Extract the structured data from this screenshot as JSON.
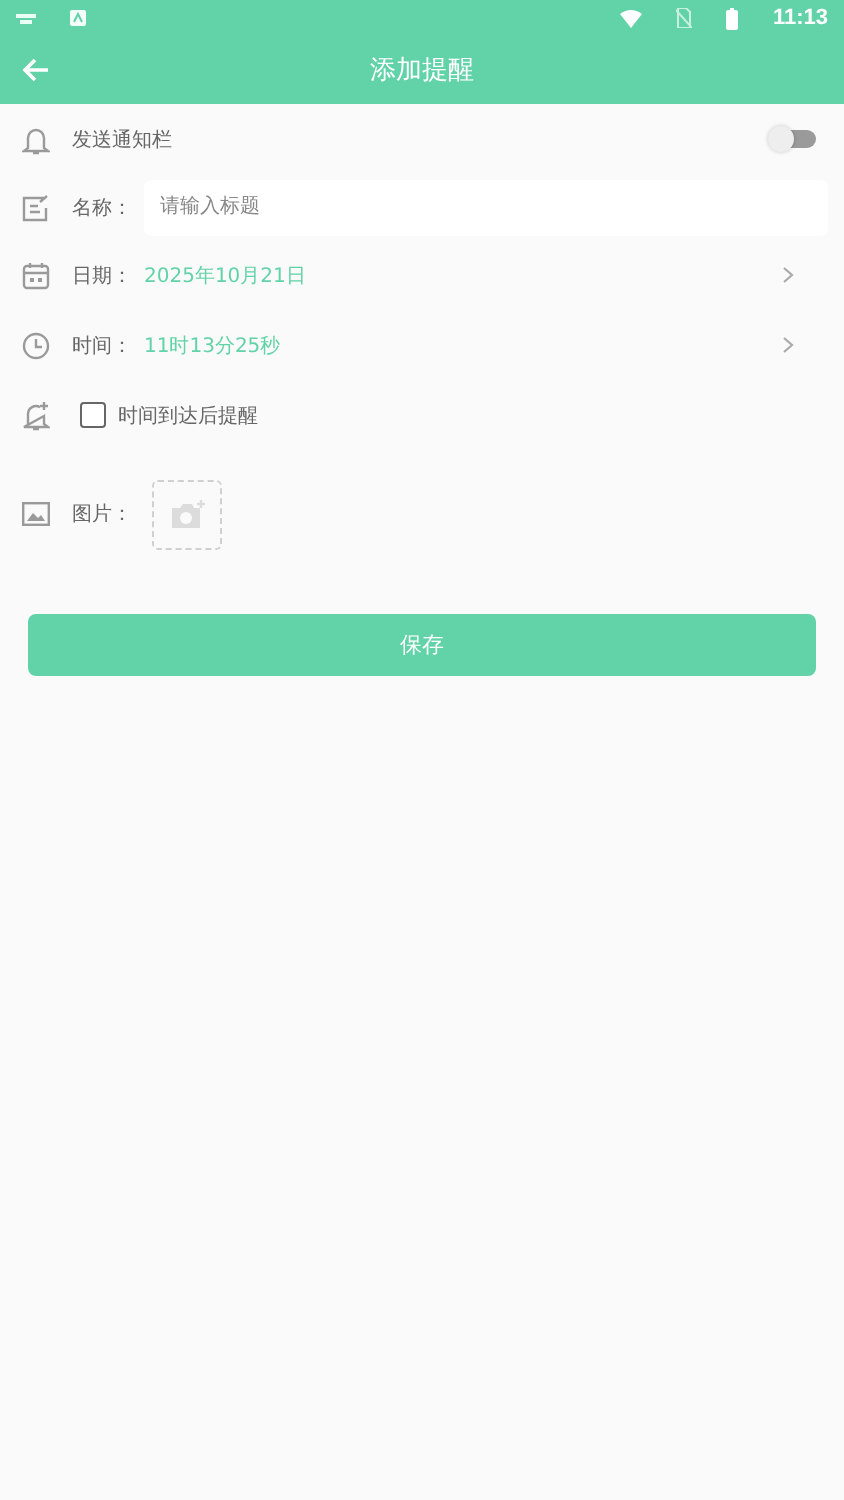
{
  "status_bar": {
    "time": "11:13"
  },
  "header": {
    "title": "添加提醒"
  },
  "form": {
    "notify": {
      "label": "发送通知栏",
      "on": false
    },
    "name": {
      "label": "名称：",
      "placeholder": "请输入标题"
    },
    "date": {
      "label": "日期：",
      "value": "2025年10月21日"
    },
    "time": {
      "label": "时间：",
      "value": "11时13分25秒"
    },
    "remind": {
      "label": "时间到达后提醒",
      "checked": false
    },
    "image": {
      "label": "图片："
    }
  },
  "save_button": "保存"
}
